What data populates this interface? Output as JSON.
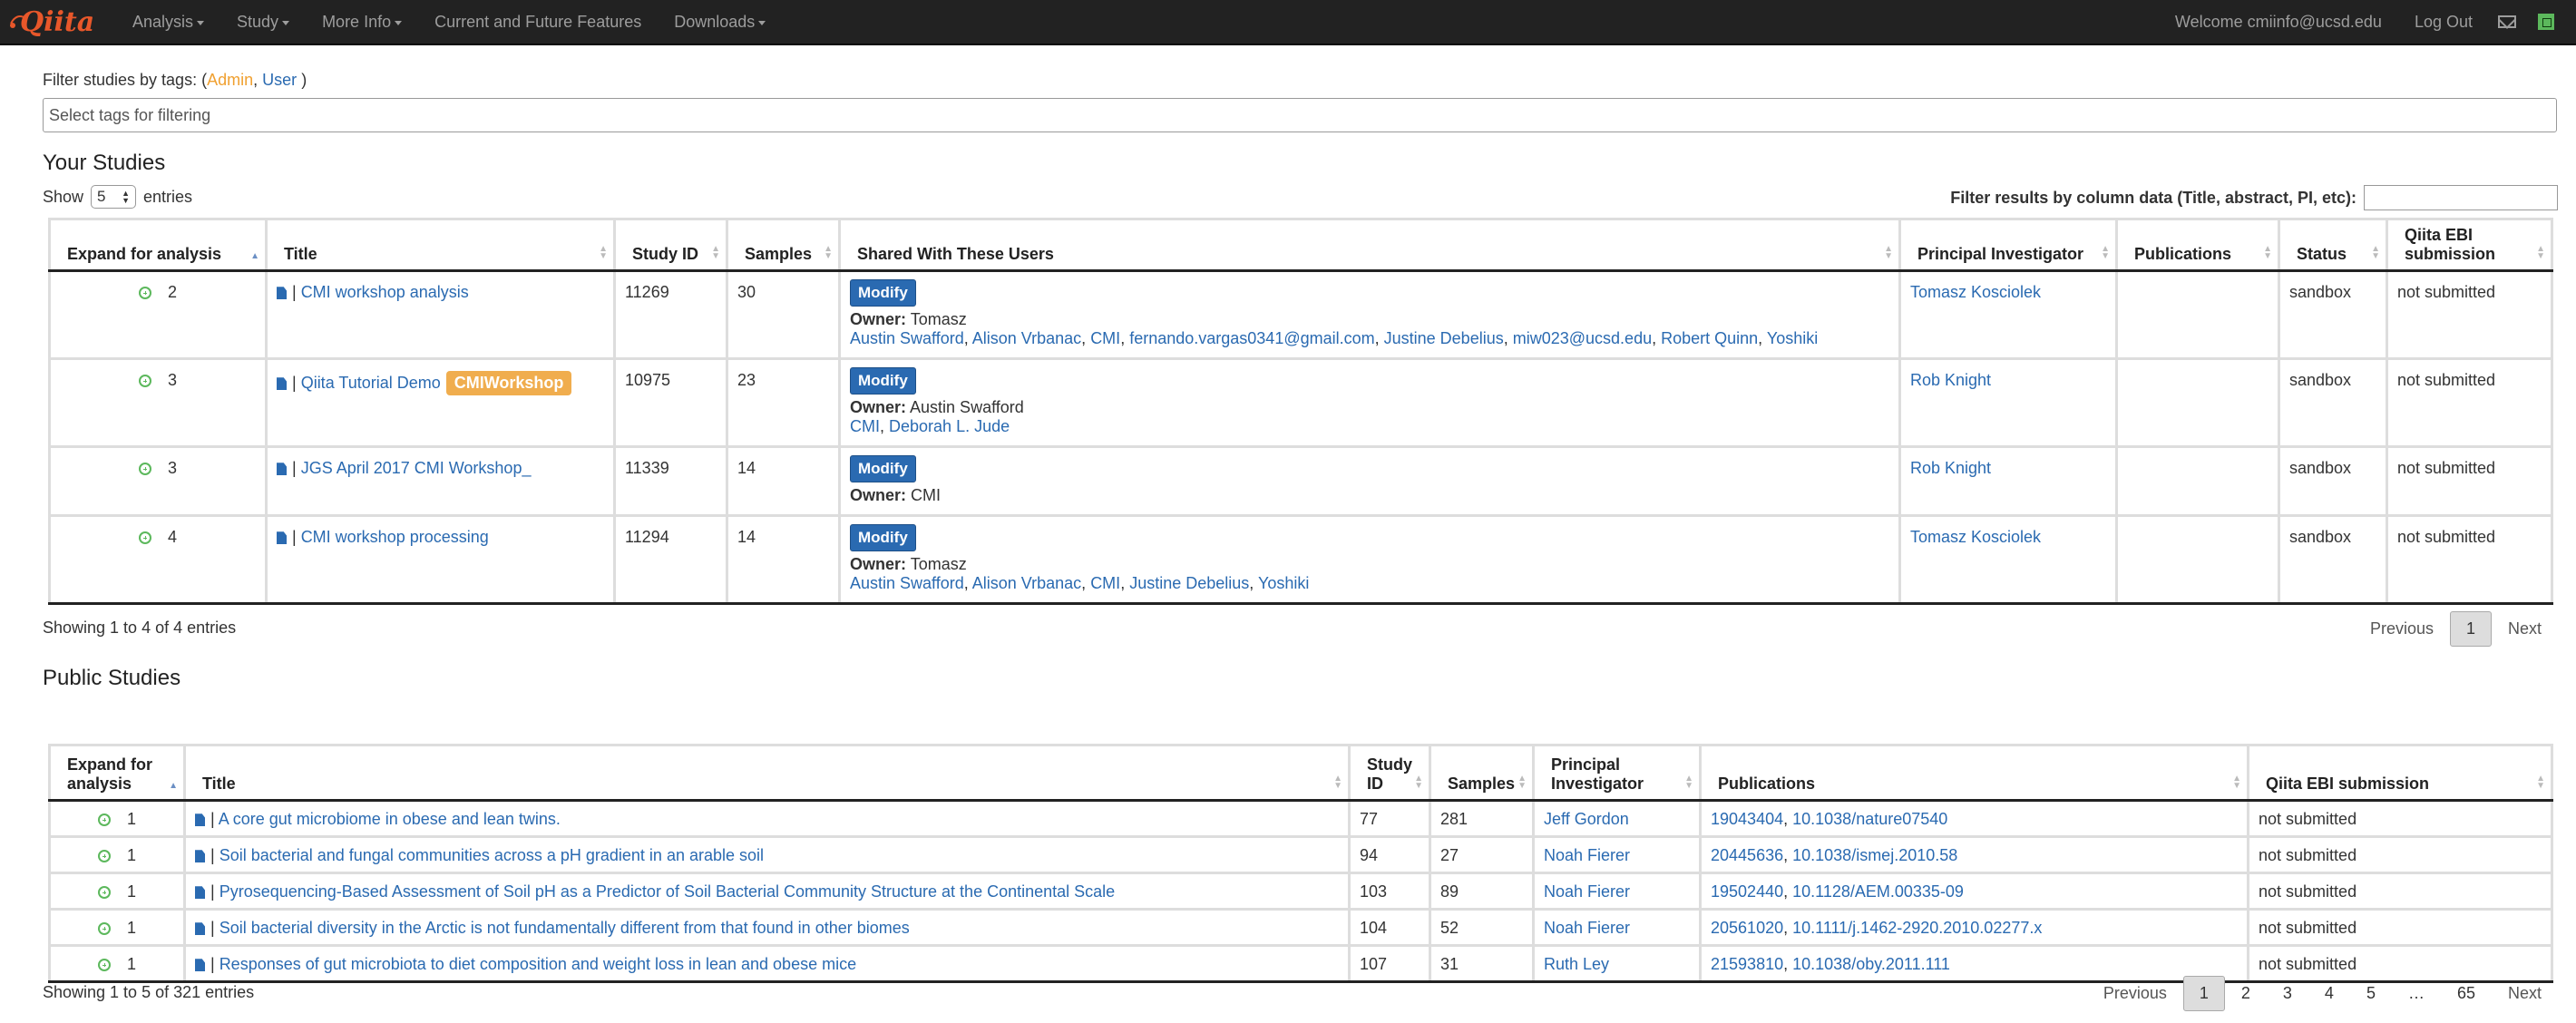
{
  "nav": {
    "brand": "Qiita",
    "items": [
      "Analysis",
      "Study",
      "More Info",
      "Current and Future Features",
      "Downloads"
    ],
    "welcome": "Welcome cmiinfo@ucsd.edu",
    "logout": "Log Out"
  },
  "filter": {
    "label": "Filter studies by tags:",
    "open_paren": "(",
    "tag_admin": "Admin",
    "sep": ",",
    "tag_user": "User",
    "close_paren": ")",
    "placeholder": "Select tags for filtering"
  },
  "your_studies": {
    "heading": "Your Studies",
    "show_label": "Show",
    "show_value": "5",
    "entries_label": "entries",
    "filter_results_label": "Filter results by column data (Title, abstract, PI, etc):",
    "columns": [
      "Expand for analysis",
      "Title",
      "Study ID",
      "Samples",
      "Shared With These Users",
      "Principal Investigator",
      "Publications",
      "Status",
      "Qiita EBI submission"
    ],
    "modify_label": "Modify",
    "owner_label": "Owner:",
    "rows": [
      {
        "count": "2",
        "title": "CMI workshop analysis",
        "badge": "",
        "study_id": "11269",
        "samples": "30",
        "owner": "Tomasz",
        "shared": [
          "Austin Swafford",
          "Alison Vrbanac",
          "CMI",
          "fernando.vargas0341@gmail.com",
          "Justine Debelius",
          "miw023@ucsd.edu",
          "Robert Quinn",
          "Yoshiki"
        ],
        "pi": "Tomasz Kosciolek",
        "status": "sandbox",
        "ebi": "not submitted"
      },
      {
        "count": "3",
        "title": "Qiita Tutorial Demo",
        "badge": "CMIWorkshop",
        "study_id": "10975",
        "samples": "23",
        "owner": "Austin Swafford",
        "shared": [
          "CMI",
          "Deborah L. Jude"
        ],
        "pi": "Rob Knight",
        "status": "sandbox",
        "ebi": "not submitted"
      },
      {
        "count": "3",
        "title": "JGS April 2017 CMI Workshop_",
        "badge": "",
        "study_id": "11339",
        "samples": "14",
        "owner": "CMI",
        "shared": [],
        "pi": "Rob Knight",
        "status": "sandbox",
        "ebi": "not submitted"
      },
      {
        "count": "4",
        "title": "CMI workshop processing",
        "badge": "",
        "study_id": "11294",
        "samples": "14",
        "owner": "Tomasz",
        "shared": [
          "Austin Swafford",
          "Alison Vrbanac",
          "CMI",
          "Justine Debelius",
          "Yoshiki"
        ],
        "pi": "Tomasz Kosciolek",
        "status": "sandbox",
        "ebi": "not submitted"
      }
    ],
    "info": "Showing 1 to 4 of 4 entries",
    "pager": [
      "Previous",
      "1",
      "Next"
    ]
  },
  "public_studies": {
    "heading": "Public Studies",
    "columns": [
      "Expand for analysis",
      "Title",
      "Study ID",
      "Samples",
      "Principal Investigator",
      "Publications",
      "Qiita EBI submission"
    ],
    "rows": [
      {
        "count": "1",
        "title": "A core gut microbiome in obese and lean twins.",
        "study_id": "77",
        "samples": "281",
        "pi": "Jeff Gordon",
        "pubs": [
          "19043404",
          "10.1038/nature07540"
        ],
        "ebi": "not submitted"
      },
      {
        "count": "1",
        "title": "Soil bacterial and fungal communities across a pH gradient in an arable soil",
        "study_id": "94",
        "samples": "27",
        "pi": "Noah Fierer",
        "pubs": [
          "20445636",
          "10.1038/ismej.2010.58"
        ],
        "ebi": "not submitted"
      },
      {
        "count": "1",
        "title": "Pyrosequencing-Based Assessment of Soil pH as a Predictor of Soil Bacterial Community Structure at the Continental Scale",
        "study_id": "103",
        "samples": "89",
        "pi": "Noah Fierer",
        "pubs": [
          "19502440",
          "10.1128/AEM.00335-09"
        ],
        "ebi": "not submitted"
      },
      {
        "count": "1",
        "title": "Soil bacterial diversity in the Arctic is not fundamentally different from that found in other biomes",
        "study_id": "104",
        "samples": "52",
        "pi": "Noah Fierer",
        "pubs": [
          "20561020",
          "10.1111/j.1462-2920.2010.02277.x"
        ],
        "ebi": "not submitted"
      },
      {
        "count": "1",
        "title": "Responses of gut microbiota to diet composition and weight loss in lean and obese mice",
        "study_id": "107",
        "samples": "31",
        "pi": "Ruth Ley",
        "pubs": [
          "21593810",
          "10.1038/oby.2011.111"
        ],
        "ebi": "not submitted"
      }
    ],
    "info": "Showing 1 to 5 of 321 entries",
    "pager": [
      "Previous",
      "1",
      "2",
      "3",
      "4",
      "5",
      "…",
      "65",
      "Next"
    ]
  }
}
